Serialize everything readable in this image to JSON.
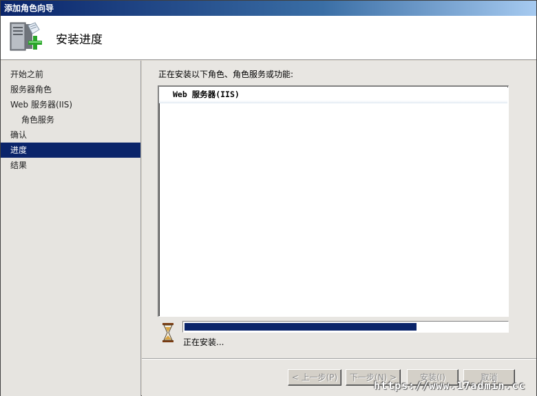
{
  "window": {
    "title": "添加角色向导"
  },
  "header": {
    "title": "安装进度",
    "icon": "server-add-icon"
  },
  "sidebar": {
    "items": [
      {
        "label": "开始之前",
        "level": 0,
        "active": false
      },
      {
        "label": "服务器角色",
        "level": 0,
        "active": false
      },
      {
        "label": "Web 服务器(IIS)",
        "level": 0,
        "active": false
      },
      {
        "label": "角色服务",
        "level": 1,
        "active": false
      },
      {
        "label": "确认",
        "level": 0,
        "active": false
      },
      {
        "label": "进度",
        "level": 0,
        "active": true
      },
      {
        "label": "结果",
        "level": 0,
        "active": false
      }
    ]
  },
  "main": {
    "label": "正在安装以下角色、角色服务或功能:",
    "list": [
      "Web 服务器(IIS)"
    ],
    "progress": {
      "percent": 72,
      "status": "正在安装..."
    }
  },
  "footer": {
    "prev_label": "< 上一步(P)",
    "next_label": "下一步(N) >",
    "install_label": "安装(I)",
    "cancel_label": "取消"
  },
  "watermark": "https://www.17admin.cc",
  "colors": {
    "accent": "#0a246a",
    "titlebar": "#0a246a"
  }
}
